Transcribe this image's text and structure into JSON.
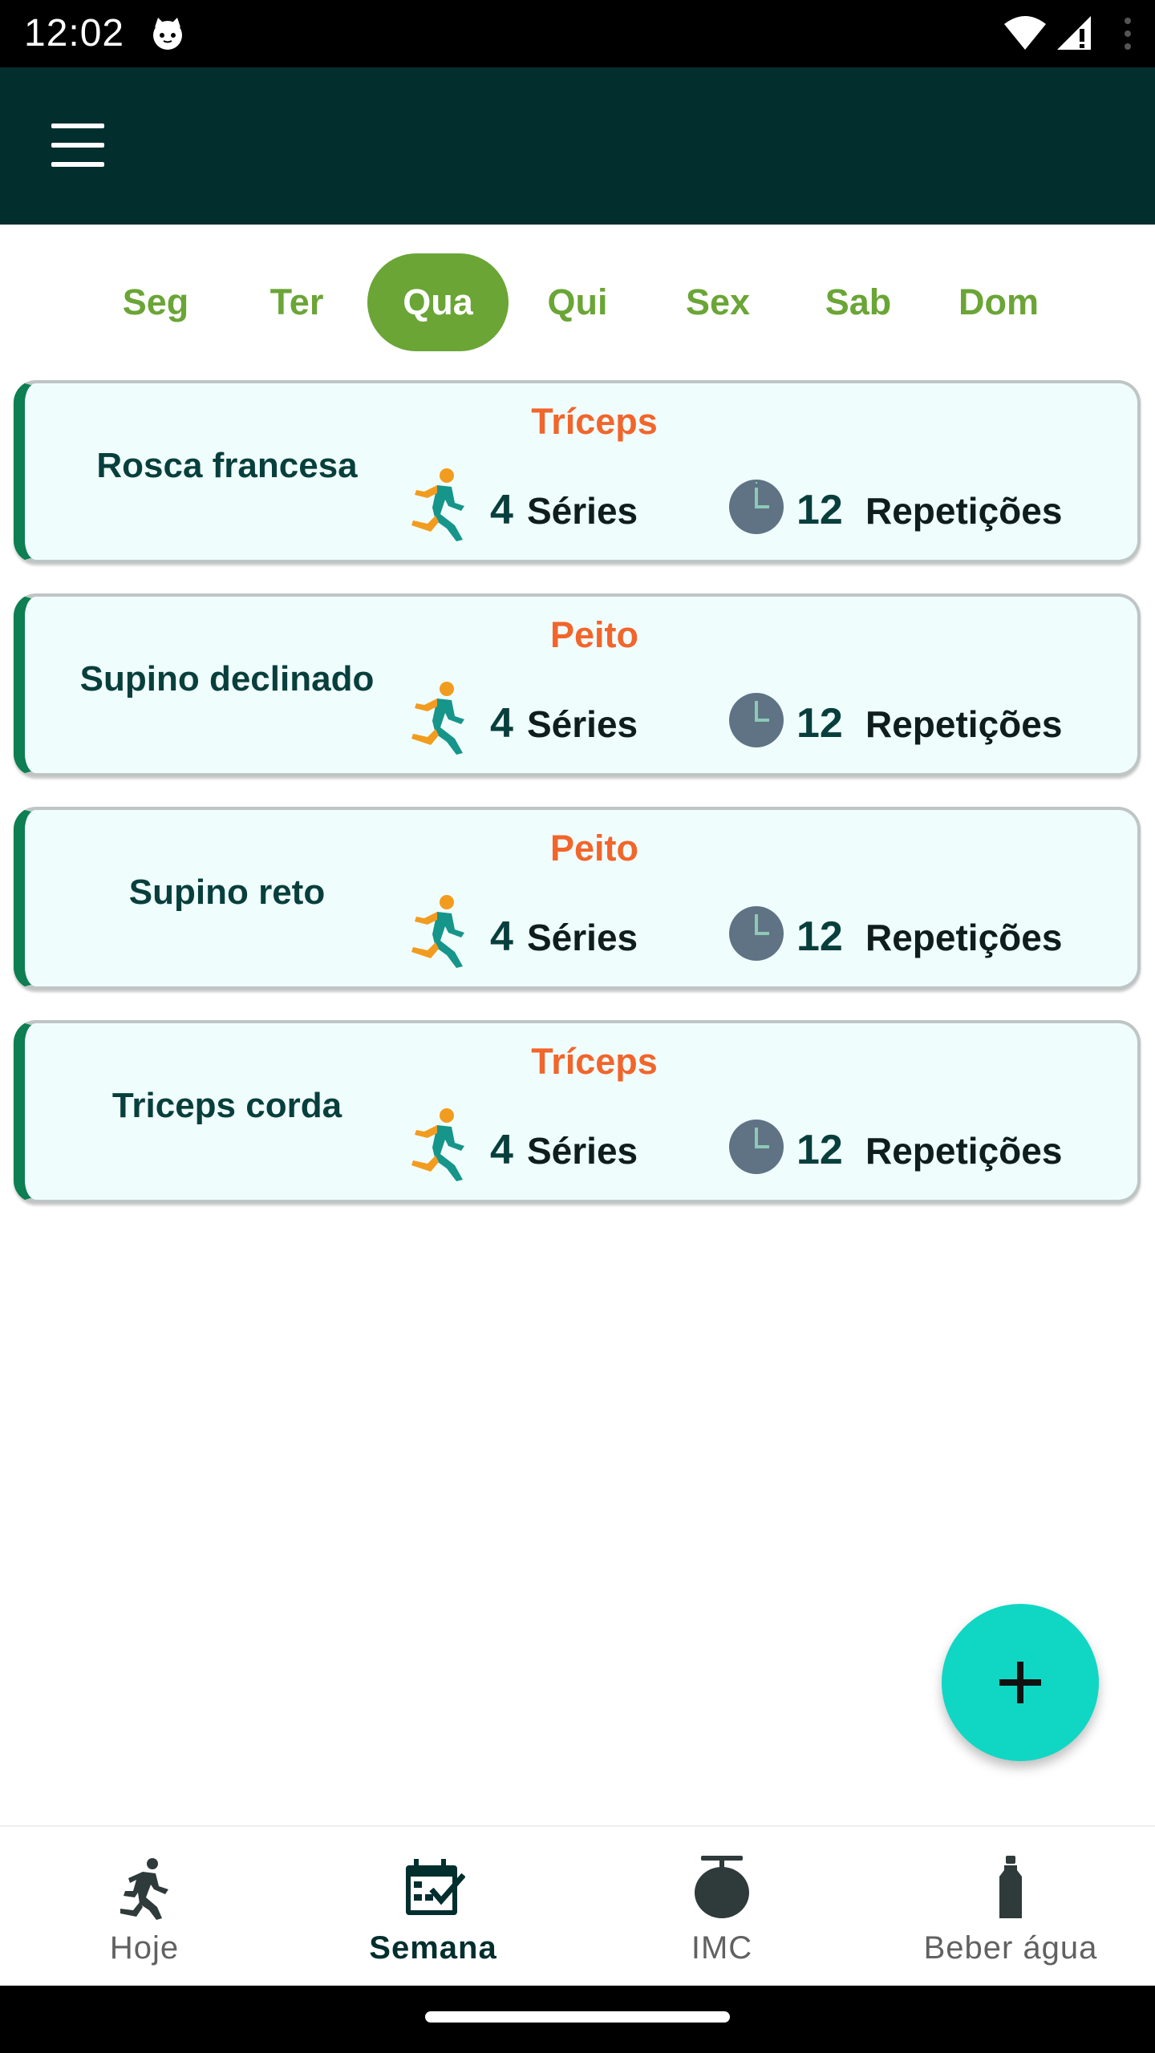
{
  "status_bar": {
    "time": "12:02"
  },
  "days": [
    "Seg",
    "Ter",
    "Qua",
    "Qui",
    "Sex",
    "Sab",
    "Dom"
  ],
  "selected_day": "Qua",
  "exercises": [
    {
      "name": "Rosca francesa",
      "group": "Tríceps",
      "series": "4",
      "series_label": "Séries",
      "reps": "12",
      "reps_label": "Repetições"
    },
    {
      "name": "Supino declinado",
      "group": "Peito",
      "series": "4",
      "series_label": "Séries",
      "reps": "12",
      "reps_label": "Repetições"
    },
    {
      "name": "Supino reto",
      "group": "Peito",
      "series": "4",
      "series_label": "Séries",
      "reps": "12",
      "reps_label": "Repetições"
    },
    {
      "name": "Triceps corda",
      "group": "Tríceps",
      "series": "4",
      "series_label": "Séries",
      "reps": "12",
      "reps_label": "Repetições"
    }
  ],
  "bottom_nav": [
    {
      "label": "Hoje",
      "icon": "runner-icon",
      "active": false
    },
    {
      "label": "Semana",
      "icon": "calendar-check-icon",
      "active": true
    },
    {
      "label": "IMC",
      "icon": "scale-icon",
      "active": false
    },
    {
      "label": "Beber água",
      "icon": "water-bottle-icon",
      "active": false
    }
  ],
  "colors": {
    "app_bar": "#032e2e",
    "tab_active": "#6aa536",
    "muscle_group": "#f2652b",
    "card_background": "#f0fdfd",
    "card_accent": "#0d7f52",
    "fab": "#0fd7c4"
  }
}
